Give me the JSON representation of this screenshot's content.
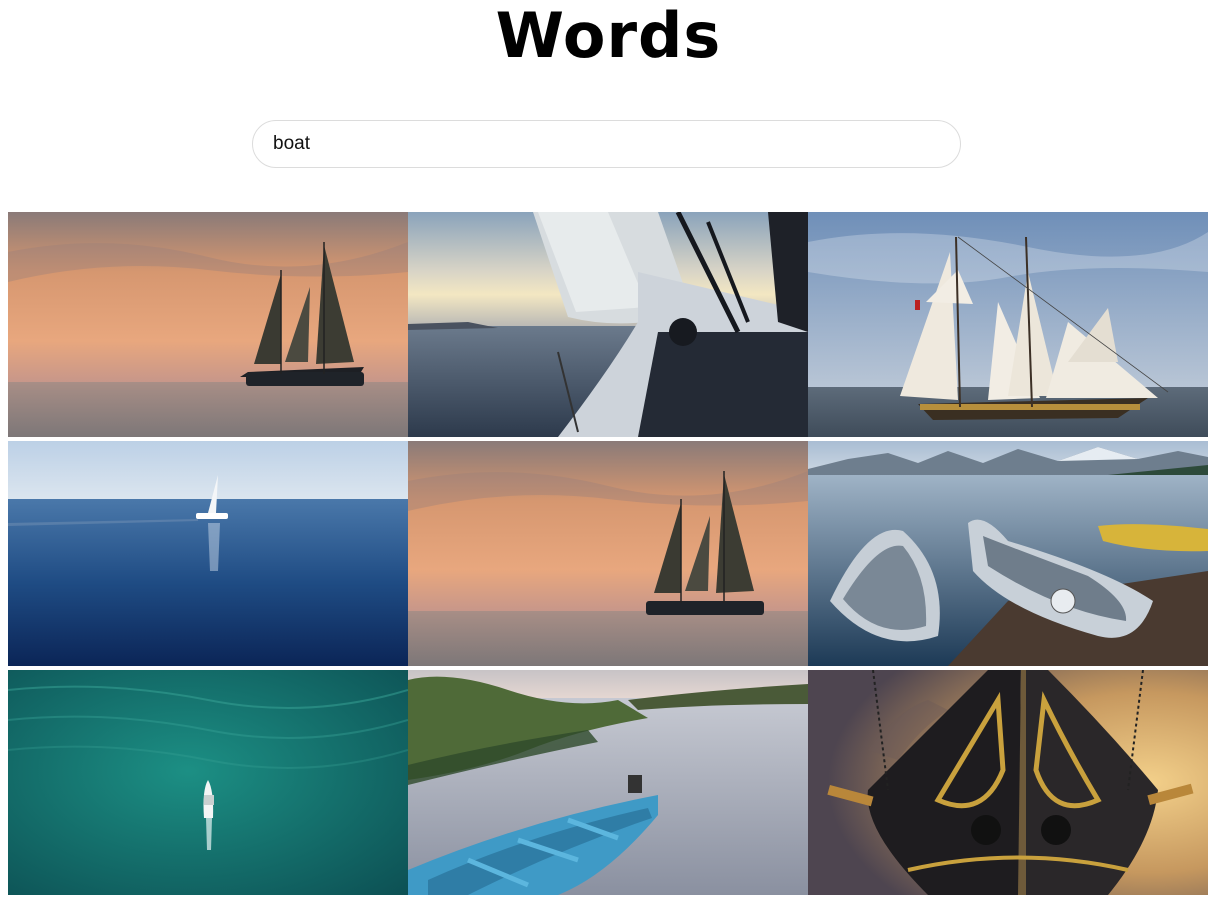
{
  "header": {
    "title": "Words"
  },
  "search": {
    "value": "boat"
  },
  "gallery": {
    "images": [
      {
        "subject": "sailboat-sunset"
      },
      {
        "subject": "sail-deck-sunrise"
      },
      {
        "subject": "tall-ship"
      },
      {
        "subject": "small-sailboat-blue-sea"
      },
      {
        "subject": "sailboat-sunset"
      },
      {
        "subject": "canoes-lake-mountains"
      },
      {
        "subject": "motorboat-aerial-green-sea"
      },
      {
        "subject": "rowboat-lake"
      },
      {
        "subject": "ship-bow-figurehead"
      }
    ]
  }
}
